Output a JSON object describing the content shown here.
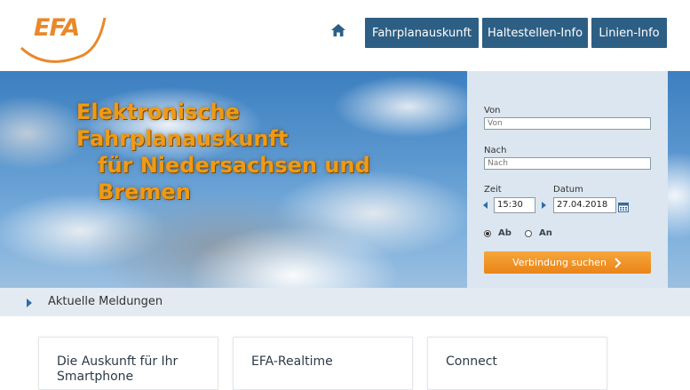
{
  "header": {
    "logo_text": "EFA",
    "nav": [
      {
        "label": "Fahrplanauskunft"
      },
      {
        "label": "Haltestellen-Info"
      },
      {
        "label": "Linien-Info"
      }
    ]
  },
  "hero": {
    "title_lines": [
      "Elektronische",
      "Fahrplanauskunft",
      "für Niedersachsen und",
      "Bremen"
    ]
  },
  "form": {
    "from_label": "Von",
    "from_placeholder": "Von",
    "to_label": "Nach",
    "to_placeholder": "Nach",
    "time_label": "Zeit",
    "time_value": "15:30",
    "date_label": "Datum",
    "date_value": "27.04.2018",
    "radio_departure": "Ab",
    "radio_arrival": "An",
    "selected": "Ab",
    "submit_label": "Verbindung suchen"
  },
  "news": {
    "label": "Aktuelle Meldungen"
  },
  "cards": [
    {
      "title": "Die Auskunft für Ihr Smartphone"
    },
    {
      "title": "EFA-Realtime"
    },
    {
      "title": "Connect"
    }
  ],
  "colors": {
    "accent": "#e8892a",
    "nav_bg": "#2d5f84",
    "panel_bg": "#dce6f0"
  }
}
